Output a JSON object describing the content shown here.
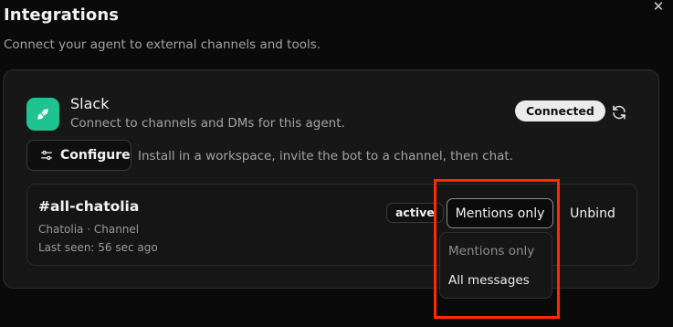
{
  "header": {
    "title": "Integrations",
    "subtitle": "Connect your agent to external channels and tools.",
    "close_icon": "close-icon"
  },
  "integration": {
    "name": "Slack",
    "description": "Connect to channels and DMs for this agent.",
    "icon": "plug-icon",
    "icon_color": "#1ec38f",
    "status": "Connected",
    "configure_label": "Configure",
    "install_hint": "Install in a workspace, invite the bot to a channel, then chat."
  },
  "binding": {
    "channel": "#all-chatolia",
    "meta": "Chatolia · Channel",
    "last_seen": "Last seen: 56 sec ago",
    "state": "active",
    "mode": "Mentions only",
    "unbind_label": "Unbind"
  },
  "dropdown": {
    "options": [
      "Mentions only",
      "All messages"
    ]
  },
  "colors": {
    "highlight": "#ff2a00",
    "background": "#0a0a0a"
  }
}
